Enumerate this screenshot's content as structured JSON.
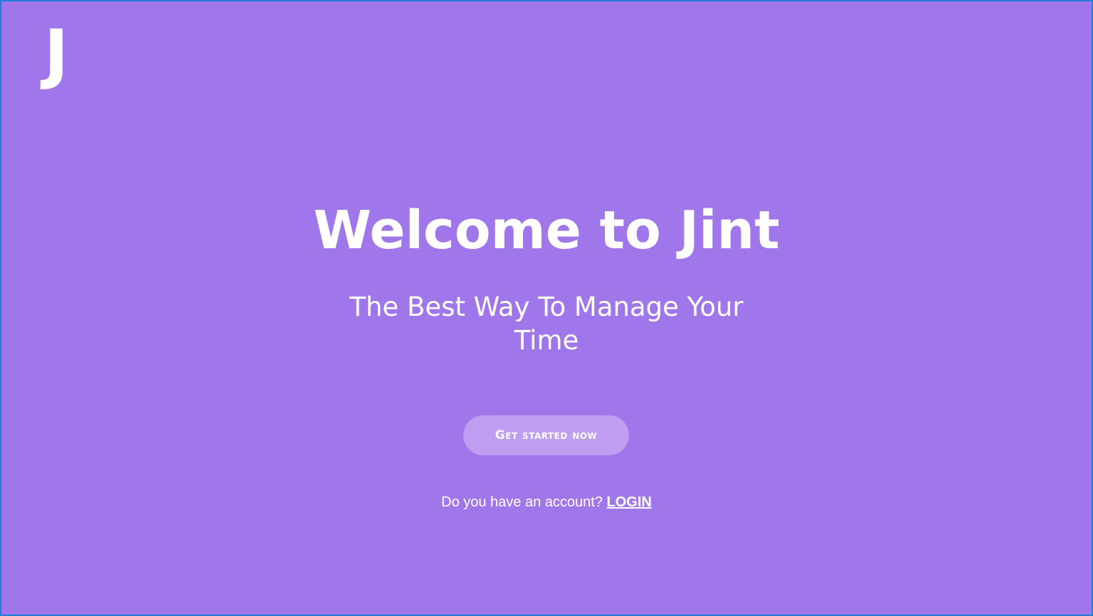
{
  "logo": {
    "text": "J"
  },
  "hero": {
    "title": "Welcome to Jint",
    "subtitle": "The Best Way To Manage Your Time"
  },
  "cta": {
    "label": "Get started now"
  },
  "account": {
    "prompt": "Do you have an account?",
    "login_label": "LOGIN"
  },
  "colors": {
    "background": "#a077eb",
    "button": "#bf9df0",
    "border": "#1f7fd6",
    "text": "#ffffff"
  }
}
